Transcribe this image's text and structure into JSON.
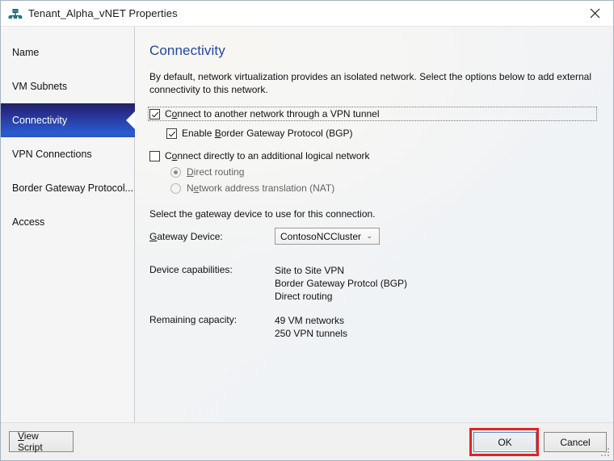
{
  "window": {
    "title": "Tenant_Alpha_vNET Properties",
    "icon": "network-vnet-icon",
    "close_label": "✕",
    "accent_blue": "#23479c",
    "selected_nav_gradient_top": "#22225e",
    "selected_nav_gradient_bottom": "#2b5bd0",
    "highlight_red": "#e8211b"
  },
  "sidebar": {
    "items": [
      {
        "label": "Name",
        "selected": false
      },
      {
        "label": "VM Subnets",
        "selected": false
      },
      {
        "label": "Connectivity",
        "selected": true
      },
      {
        "label": "VPN Connections",
        "selected": false
      },
      {
        "label": "Border Gateway Protocol...",
        "selected": false
      },
      {
        "label": "Access",
        "selected": false
      }
    ]
  },
  "content": {
    "title": "Connectivity",
    "intro": "By default, network virtualization provides an isolated network. Select the options below to add external connectivity to this network.",
    "options": {
      "vpn_tunnel": {
        "label_pre": "C",
        "label_acc": "o",
        "label_post": "nnect to another network through a VPN tunnel",
        "checked": true,
        "focused": true
      },
      "bgp": {
        "label_pre": "Enable ",
        "label_acc": "B",
        "label_post": "order Gateway Protocol (BGP)",
        "checked": true
      },
      "logical_network": {
        "label_pre": "C",
        "label_acc": "o",
        "label_post": "nnect directly to an additional logical network",
        "checked": false
      },
      "direct_routing": {
        "label_pre": "",
        "label_acc": "D",
        "label_post": "irect routing",
        "selected": true,
        "disabled": true
      },
      "nat": {
        "label_pre": "N",
        "label_acc": "e",
        "label_post": "twork address translation (NAT)",
        "selected": false,
        "disabled": true
      }
    },
    "gateway": {
      "intro": "Select the gateway device to use for this connection.",
      "label_pre": "",
      "label_acc": "G",
      "label_post": "ateway Device:",
      "selected_value": "ContosoNCCluster",
      "chevron": "⌄"
    },
    "info": [
      {
        "key": "Device capabilities:",
        "values": [
          "Site to Site VPN",
          "Border Gateway Protcol (BGP)",
          "Direct routing"
        ]
      },
      {
        "key": "Remaining capacity:",
        "values": [
          "49 VM networks",
          "250 VPN tunnels"
        ]
      }
    ]
  },
  "footer": {
    "view_script": {
      "label_pre": "",
      "label_acc": "V",
      "label_post": "iew Script"
    },
    "ok": "OK",
    "cancel": "Cancel"
  }
}
